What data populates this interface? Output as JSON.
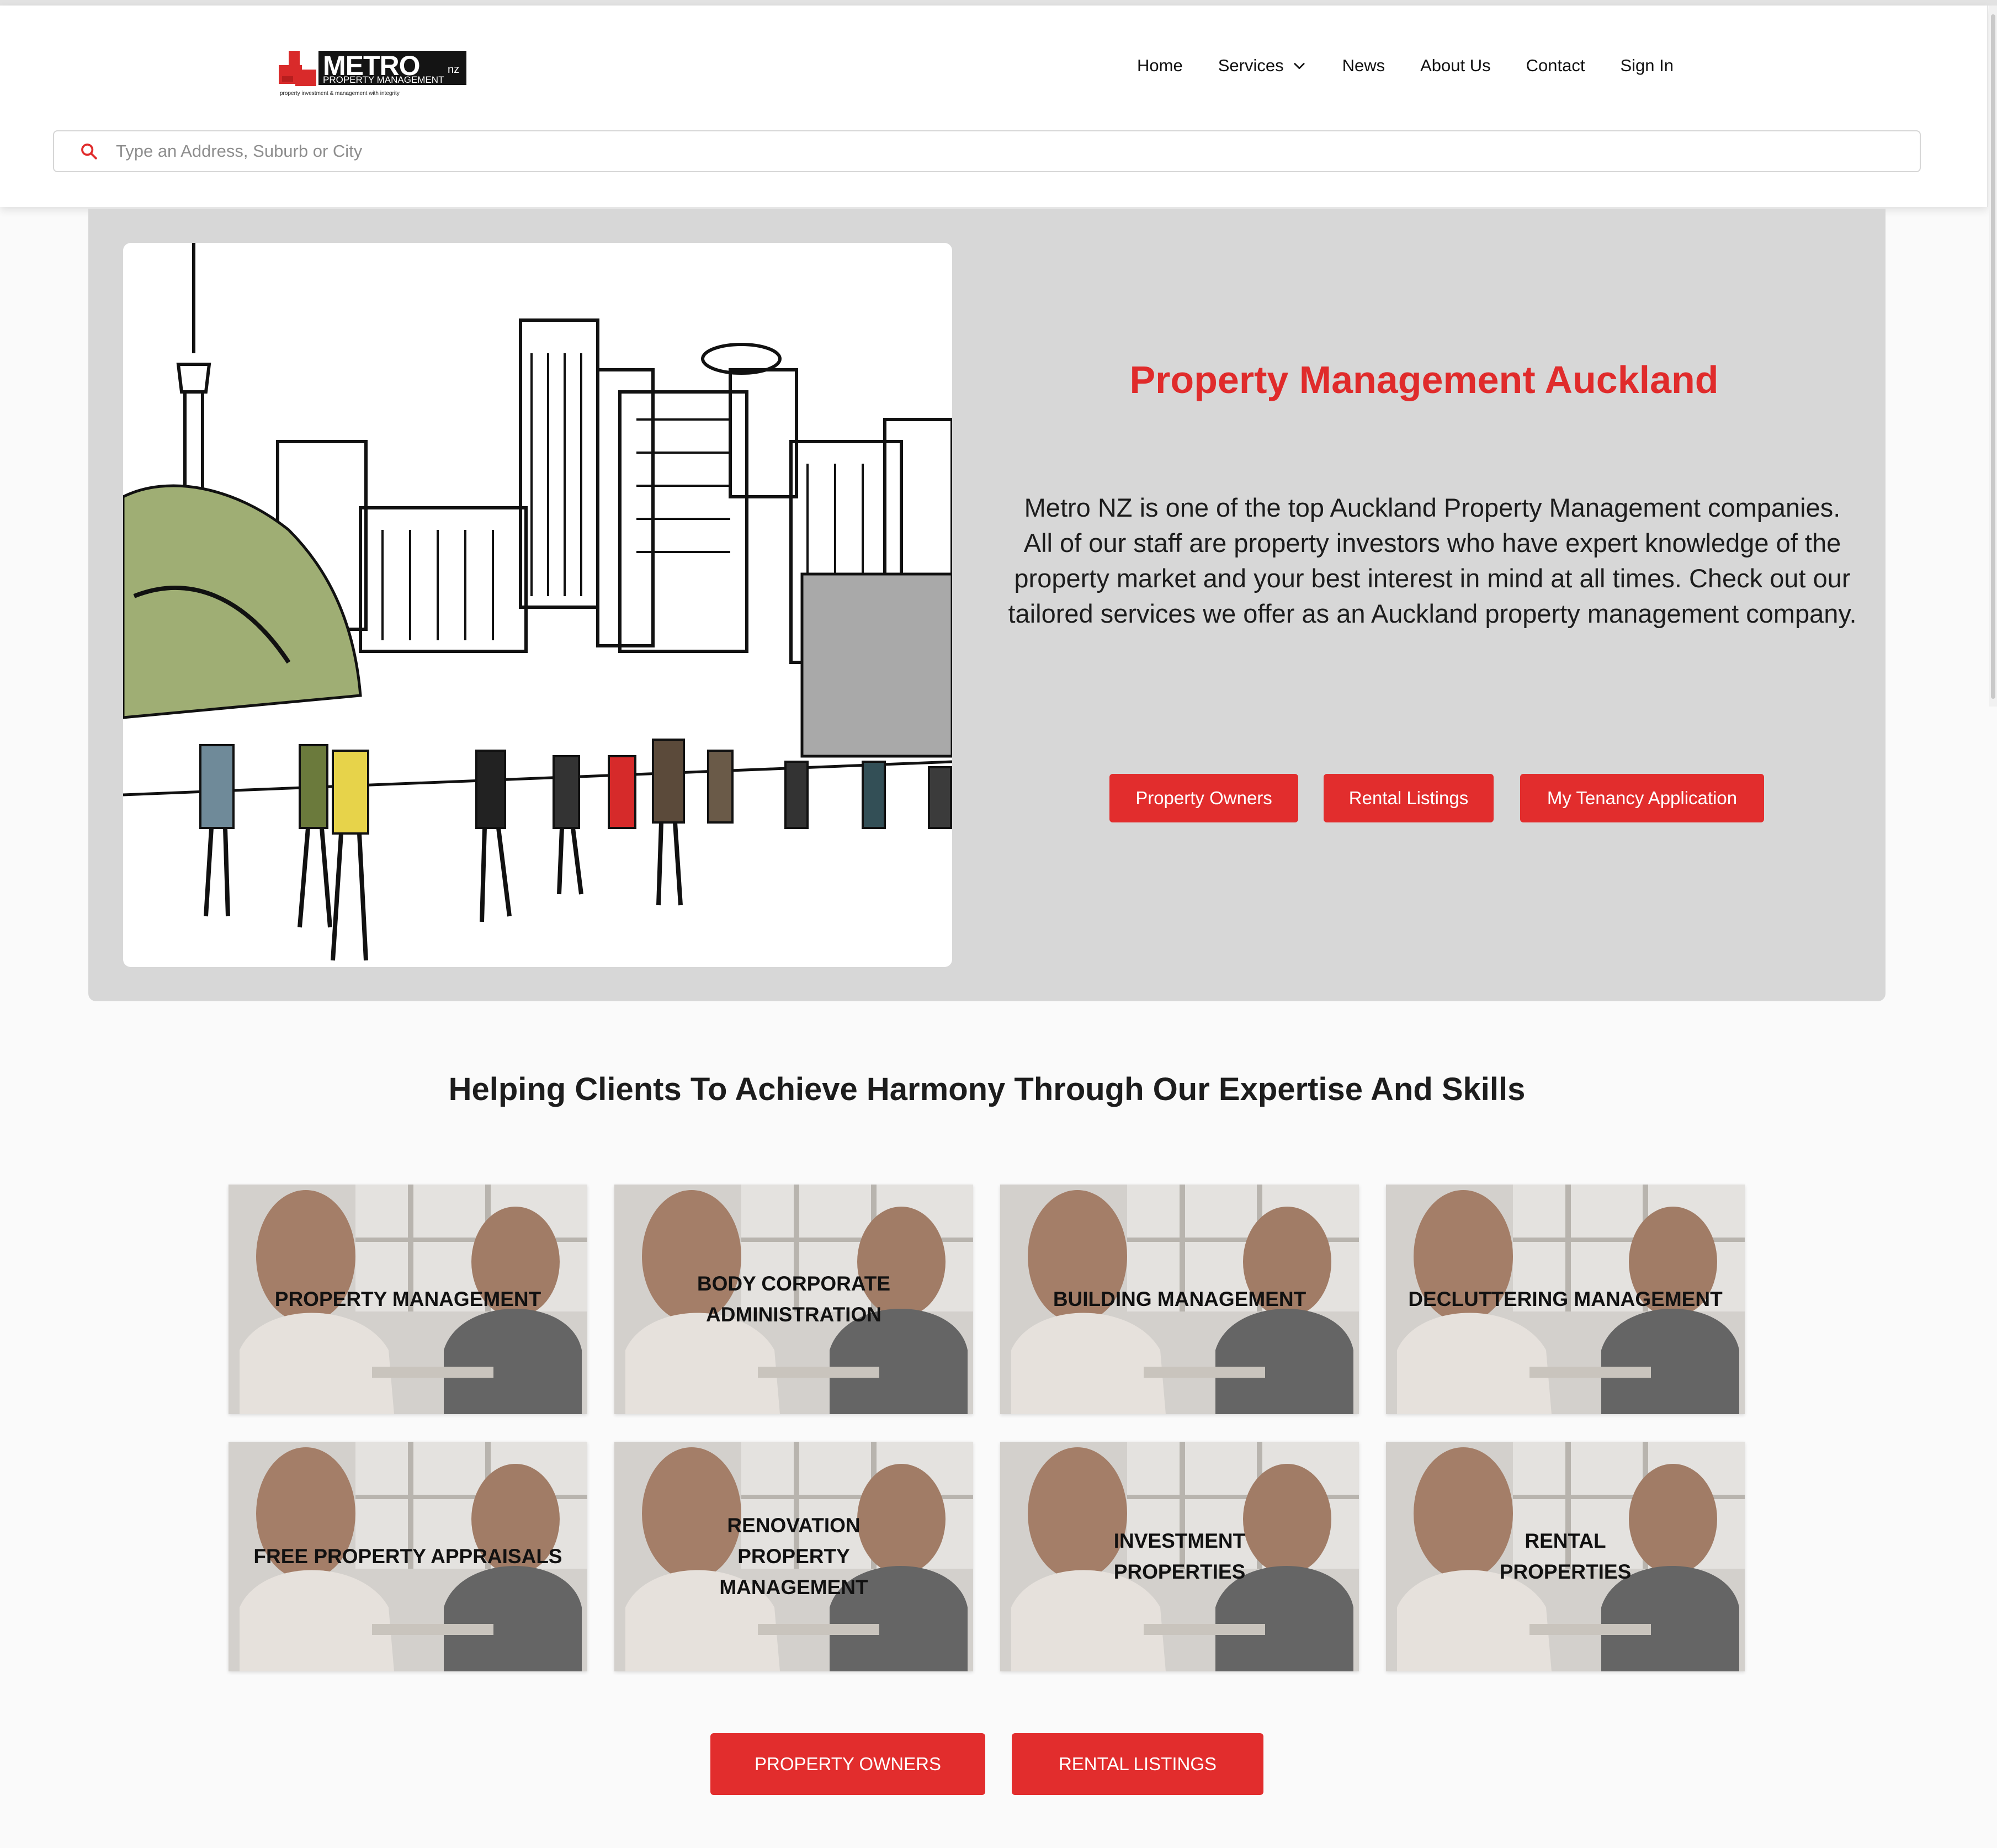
{
  "brand": {
    "logo_word": "METRO",
    "logo_suffix": "nz",
    "logo_sub": "PROPERTY MANAGEMENT",
    "logo_tagline": "property investment & management with integrity",
    "red": "#e02b2b"
  },
  "nav": {
    "items": [
      {
        "label": "Home"
      },
      {
        "label": "Services",
        "icon": "chevron-down-icon"
      },
      {
        "label": "News"
      },
      {
        "label": "About Us"
      },
      {
        "label": "Contact"
      },
      {
        "label": "Sign In"
      }
    ]
  },
  "search": {
    "placeholder": "Type an Address, Suburb or City",
    "icon": "search-icon"
  },
  "hero": {
    "title": "Property Management Auckland",
    "text": "Metro NZ is one of the top Auckland Property Management companies. All of our staff are property investors who have expert knowledge of the property market and your best interest in mind at all times. Check out our tailored services we offer as an Auckland property management company.",
    "buttons": [
      {
        "label": "Property Owners"
      },
      {
        "label": "Rental Listings"
      },
      {
        "label": "My Tenancy Application"
      }
    ]
  },
  "services": {
    "title": "Helping Clients To Achieve Harmony Through Our Expertise And Skills",
    "cards": [
      {
        "label": "PROPERTY MANAGEMENT"
      },
      {
        "label": "BODY CORPORATE ADMINISTRATION"
      },
      {
        "label": "BUILDING MANAGEMENT"
      },
      {
        "label": "DECLUTTERING MANAGEMENT"
      },
      {
        "label": "FREE PROPERTY APPRAISALS"
      },
      {
        "label": "RENOVATION PROPERTY MANAGEMENT"
      },
      {
        "label": "INVESTMENT PROPERTIES"
      },
      {
        "label": "RENTAL PROPERTIES"
      }
    ]
  },
  "bottom_buttons": [
    {
      "label": "PROPERTY OWNERS"
    },
    {
      "label": "RENTAL LISTINGS"
    }
  ]
}
